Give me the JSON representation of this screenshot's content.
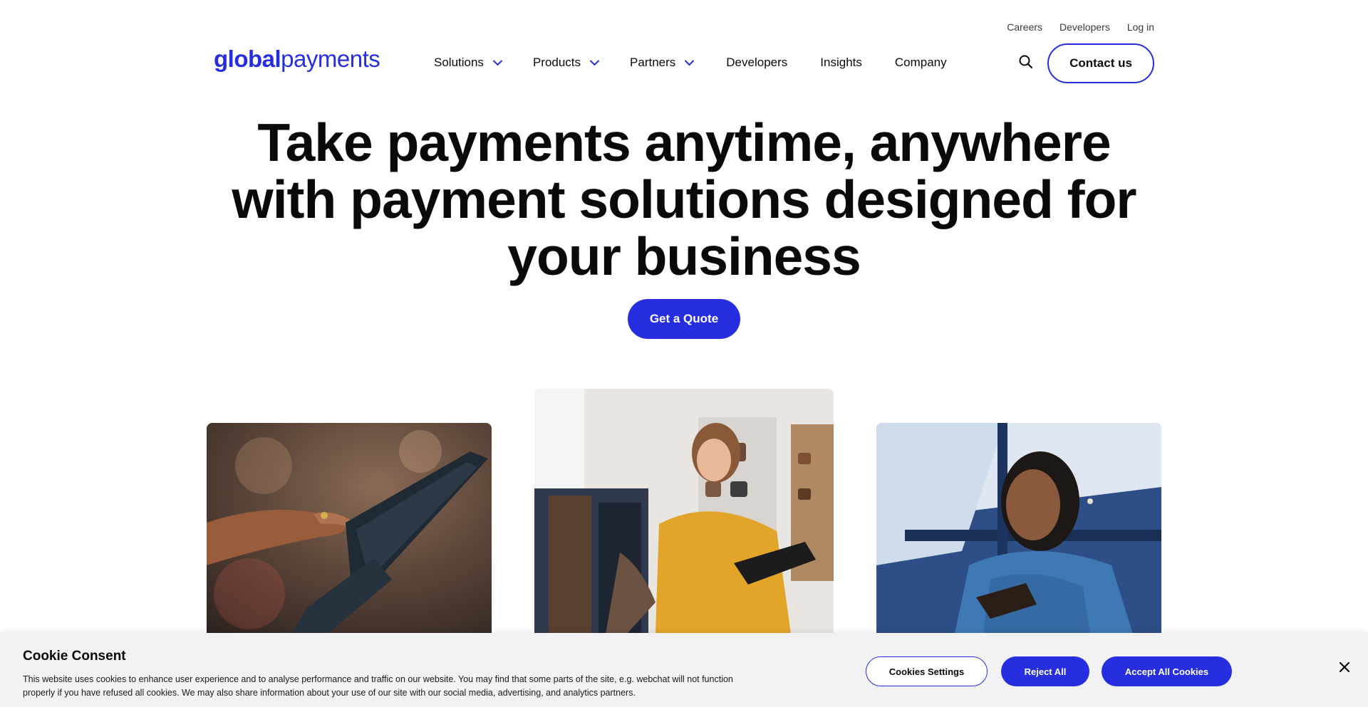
{
  "utility_nav": {
    "careers": "Careers",
    "developers": "Developers",
    "login": "Log in"
  },
  "logo": {
    "bold": "global",
    "light": "payments"
  },
  "nav": {
    "solutions": "Solutions",
    "products": "Products",
    "partners": "Partners",
    "developers": "Developers",
    "insights": "Insights",
    "company": "Company"
  },
  "header": {
    "contact_label": "Contact us",
    "search_icon": "search-icon"
  },
  "hero": {
    "line1": "Take payments anytime, anywhere",
    "line2": "with payment solutions designed for",
    "line3": "your business",
    "cta": "Get a Quote"
  },
  "cookie": {
    "title": "Cookie Consent",
    "text": "This website uses cookies to enhance user experience and to analyse performance and traffic on our website. You may find that some parts of the site, e.g. webchat will not function properly if you have refused all cookies. We may also share information about your use of our site with our social media, advertising, and analytics partners.",
    "settings": "Cookies Settings",
    "reject": "Reject All",
    "accept": "Accept All Cookies",
    "close_icon": "close-icon"
  },
  "colors": {
    "brand_blue": "#262ee0",
    "banner_bg": "#f2f2f4"
  }
}
